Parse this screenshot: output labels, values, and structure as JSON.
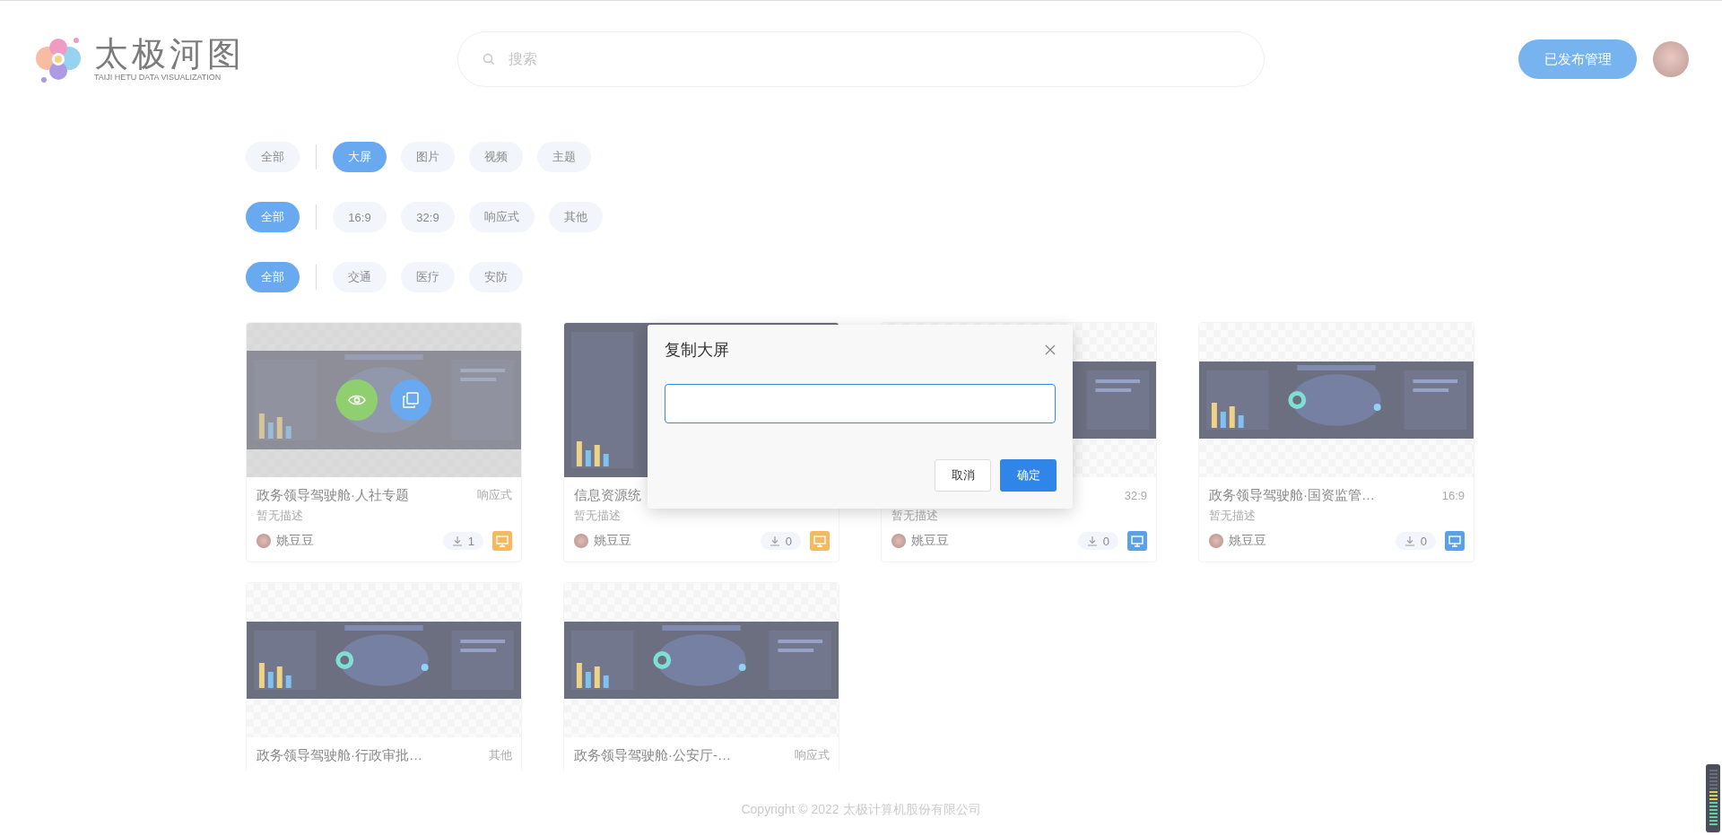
{
  "header": {
    "logo_title": "太极河图",
    "logo_subtitle": "TAIJI HETU DATA VISUALIZATION",
    "search": {
      "placeholder": "搜索"
    },
    "publish_button": "已发布管理"
  },
  "filter_rows": [
    {
      "items": [
        {
          "label": "全部",
          "selected": false
        },
        {
          "label": "大屏",
          "selected": true
        },
        {
          "label": "图片",
          "selected": false
        },
        {
          "label": "视频",
          "selected": false
        },
        {
          "label": "主题",
          "selected": false
        }
      ]
    },
    {
      "items": [
        {
          "label": "全部",
          "selected": true
        },
        {
          "label": "16:9",
          "selected": false
        },
        {
          "label": "32:9",
          "selected": false
        },
        {
          "label": "响应式",
          "selected": false
        },
        {
          "label": "其他",
          "selected": false
        }
      ]
    },
    {
      "items": [
        {
          "label": "全部",
          "selected": true
        },
        {
          "label": "交通",
          "selected": false
        },
        {
          "label": "医疗",
          "selected": false
        },
        {
          "label": "安防",
          "selected": false
        }
      ]
    }
  ],
  "cards": [
    {
      "title": "政务领导驾驶舱·人社专题",
      "tag": "响应式",
      "description": "暂无描述",
      "author": "姚豆豆",
      "downloads": "1",
      "color": "#f5b95f",
      "hovered": true
    },
    {
      "title": "信息资源统",
      "description": "暂无描述",
      "author": "姚豆豆",
      "downloads": "0",
      "color": "#f5b95f",
      "hovered": false
    },
    {
      "tag": "32:9",
      "description": "暂无描述",
      "author": "姚豆豆",
      "downloads": "0",
      "color": "#5aa1e8",
      "hovered": false
    },
    {
      "title": "政务领导驾驶舱·国资监管…",
      "tag": "16:9",
      "description": "暂无描述",
      "author": "姚豆豆",
      "downloads": "0",
      "color": "#5aa1e8",
      "hovered": false
    },
    {
      "title": "政务领导驾驶舱·行政审批…",
      "tag": "其他",
      "hovered": false
    },
    {
      "title": "政务领导驾驶舱·公安厅-…",
      "tag": "响应式",
      "hovered": false
    }
  ],
  "footer": "Copyright © 2022 太极计算机股份有限公司",
  "dialog": {
    "title": "复制大屏",
    "cancel": "取消",
    "confirm": "确定"
  }
}
